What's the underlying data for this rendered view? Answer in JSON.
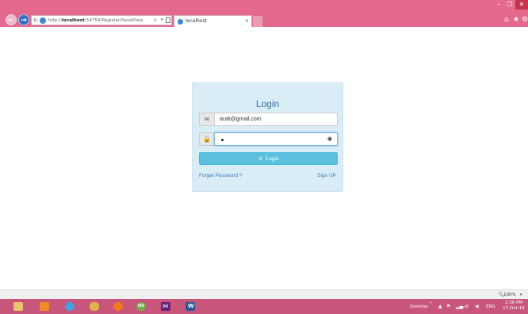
{
  "browser": {
    "window_controls": {
      "minimize": "–",
      "restore": "❐",
      "close": "✕"
    },
    "back_icon": "back-arrow-icon",
    "forward_icon": "forward-arrow-icon",
    "address": {
      "scheme": "http://",
      "host": "localhost",
      "path": ":54759/Register/SaveData",
      "search_glyph": "⌕",
      "dropdown_glyph": "▾"
    },
    "tab": {
      "title": "localhost",
      "close": "×"
    },
    "toolbar_icons": {
      "home": "⌂",
      "favorites": "★",
      "tools": "⚙"
    }
  },
  "login": {
    "title": "Login",
    "email_icon": "✉",
    "email_value": "arati@gmail.com",
    "password_icon": "🔒",
    "reveal_icon": "◉",
    "button_icon": "➲",
    "button_label": "Login",
    "forgot_label": "Forget Password ?",
    "signup_label": "Sign UP"
  },
  "statusbar": {
    "zoom_icon": "🔍",
    "zoom": "100%",
    "zoom_dropdown": "▾"
  },
  "taskbar": {
    "apps": [
      "file-explorer",
      "store",
      "internet-explorer",
      "paint",
      "firefox",
      "hs-app",
      "visual-studio",
      "word"
    ],
    "hs_label": "HS",
    "vs_label": "⋈",
    "word_label": "W",
    "desktop_label": "Desktop",
    "desktop_chevron": "»",
    "tray": {
      "up": "▲",
      "flag": "⚑",
      "signal": "▂▄",
      "network": "⇄",
      "volume": "◀"
    },
    "lang": "ENG",
    "time": "2:36 PM",
    "date": "17-Oct-16"
  },
  "colors": {
    "chrome_accent": "#e3698f",
    "taskbar": "#c7567a",
    "panel_bg": "#d9edf7",
    "title_blue": "#2e6da4",
    "button_info": "#5bc0de",
    "link_blue": "#337ab7"
  }
}
